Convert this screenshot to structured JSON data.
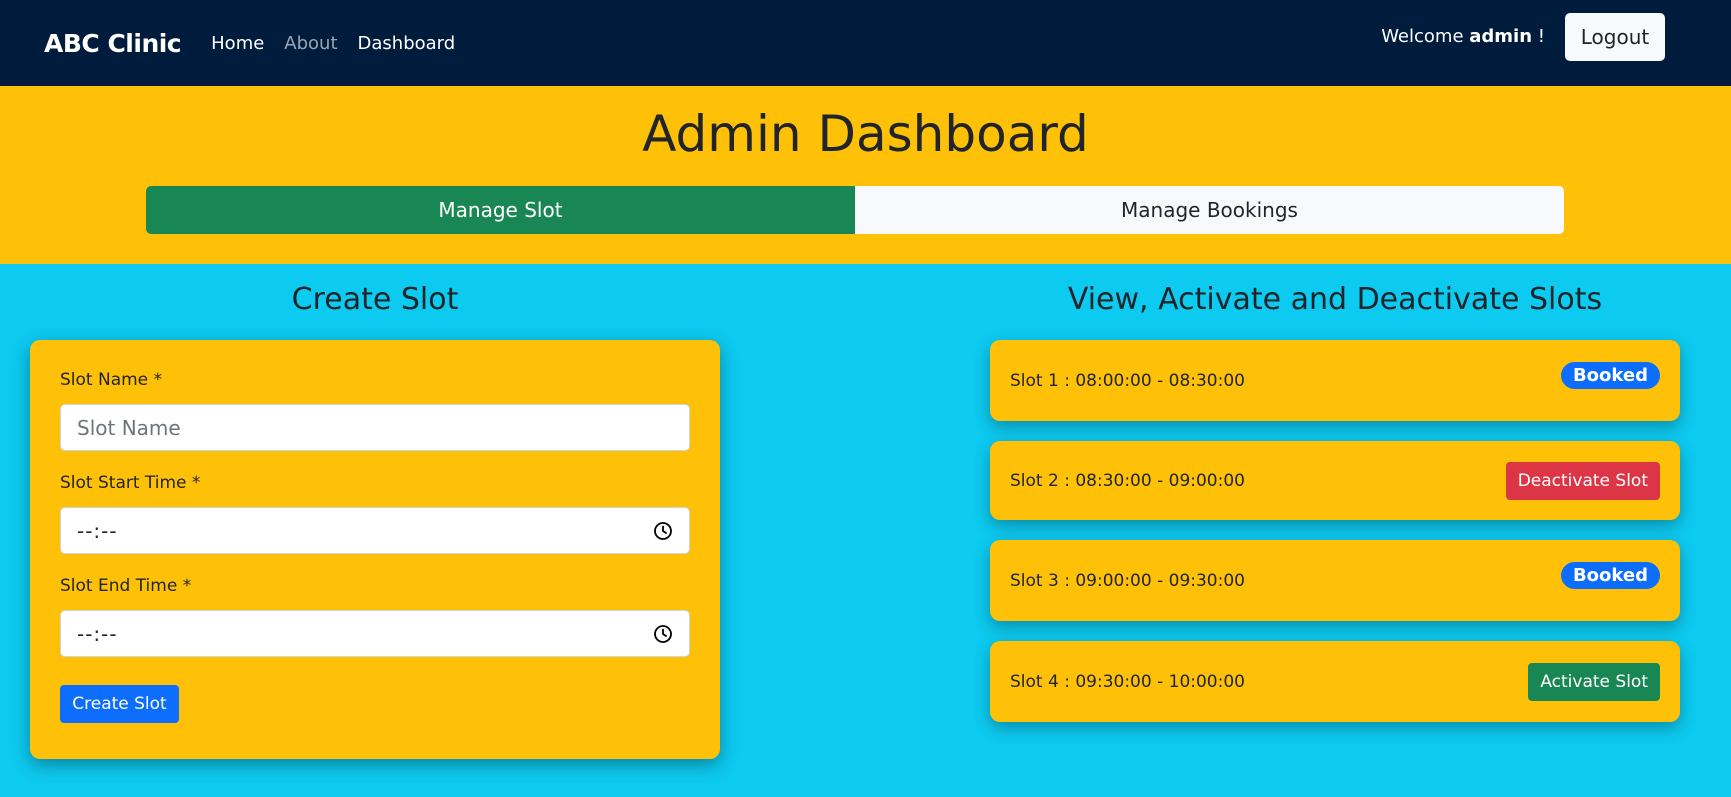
{
  "navbar": {
    "brand": "ABC Clinic",
    "links": [
      {
        "label": "Home",
        "active": true
      },
      {
        "label": "About",
        "active": false
      },
      {
        "label": "Dashboard",
        "active": true
      }
    ],
    "welcome_prefix": "Welcome",
    "username": "admin",
    "welcome_suffix": "!",
    "logout_label": "Logout"
  },
  "header": {
    "title": "Admin Dashboard",
    "tabs": [
      {
        "label": "Manage Slot",
        "active": true
      },
      {
        "label": "Manage Bookings",
        "active": false
      }
    ]
  },
  "create_slot": {
    "title": "Create Slot",
    "slot_name_label": "Slot Name *",
    "slot_name_placeholder": "Slot Name",
    "start_label": "Slot Start Time *",
    "start_value": "--:--",
    "end_label": "Slot End Time *",
    "end_value": "--:--",
    "submit_label": "Create Slot"
  },
  "slots": {
    "title": "View, Activate and Deactivate Slots",
    "items": [
      {
        "text": "Slot 1 : 08:00:00 - 08:30:00",
        "status": "Booked"
      },
      {
        "text": "Slot 2 : 08:30:00 - 09:00:00",
        "action": "Deactivate Slot"
      },
      {
        "text": "Slot 3 : 09:00:00 - 09:30:00",
        "status": "Booked"
      },
      {
        "text": "Slot 4 : 09:30:00 - 10:00:00",
        "action": "Activate Slot"
      }
    ]
  },
  "colors": {
    "navbar_bg": "#001c3d",
    "header_bg": "#ffc107",
    "main_bg": "#0dcaf0",
    "primary": "#0d6efd",
    "success": "#198754",
    "danger": "#dc3545"
  }
}
